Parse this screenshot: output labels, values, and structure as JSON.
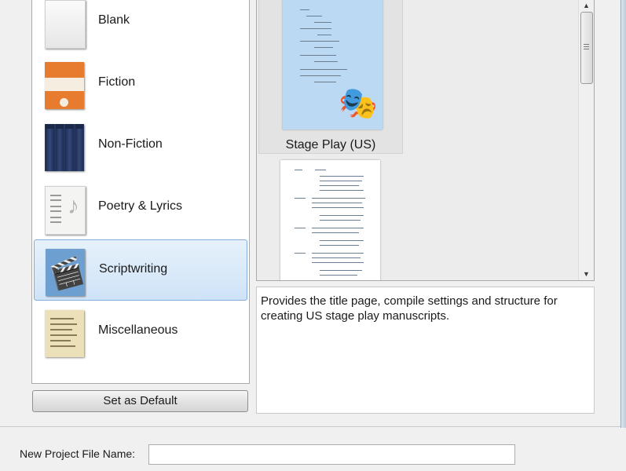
{
  "categories": [
    {
      "label": "Blank",
      "thumb_icon": "blank-page-icon"
    },
    {
      "label": "Fiction",
      "thumb_icon": "fiction-book-icon"
    },
    {
      "label": "Non-Fiction",
      "thumb_icon": "non-fiction-books-icon"
    },
    {
      "label": "Poetry & Lyrics",
      "thumb_icon": "poetry-note-icon"
    },
    {
      "label": "Scriptwriting",
      "thumb_icon": "clapperboard-icon",
      "selected": true
    },
    {
      "label": "Miscellaneous",
      "thumb_icon": "miscellaneous-page-icon"
    }
  ],
  "set_default_label": "Set as Default",
  "templates": [
    {
      "name": "Stage Play (US)",
      "selected": true,
      "thumb_icon": "theatre-masks-icon"
    },
    {
      "name": "",
      "selected": false,
      "thumb_icon": "screenplay-page-icon"
    }
  ],
  "description": "Provides the title page, compile settings and structure for creating US stage play manuscripts.",
  "file_name": {
    "label": "New Project File Name:",
    "value": "",
    "placeholder": ""
  },
  "colors": {
    "selection": "#cfe3f7",
    "selected_thumb": "#bcd9f4"
  }
}
